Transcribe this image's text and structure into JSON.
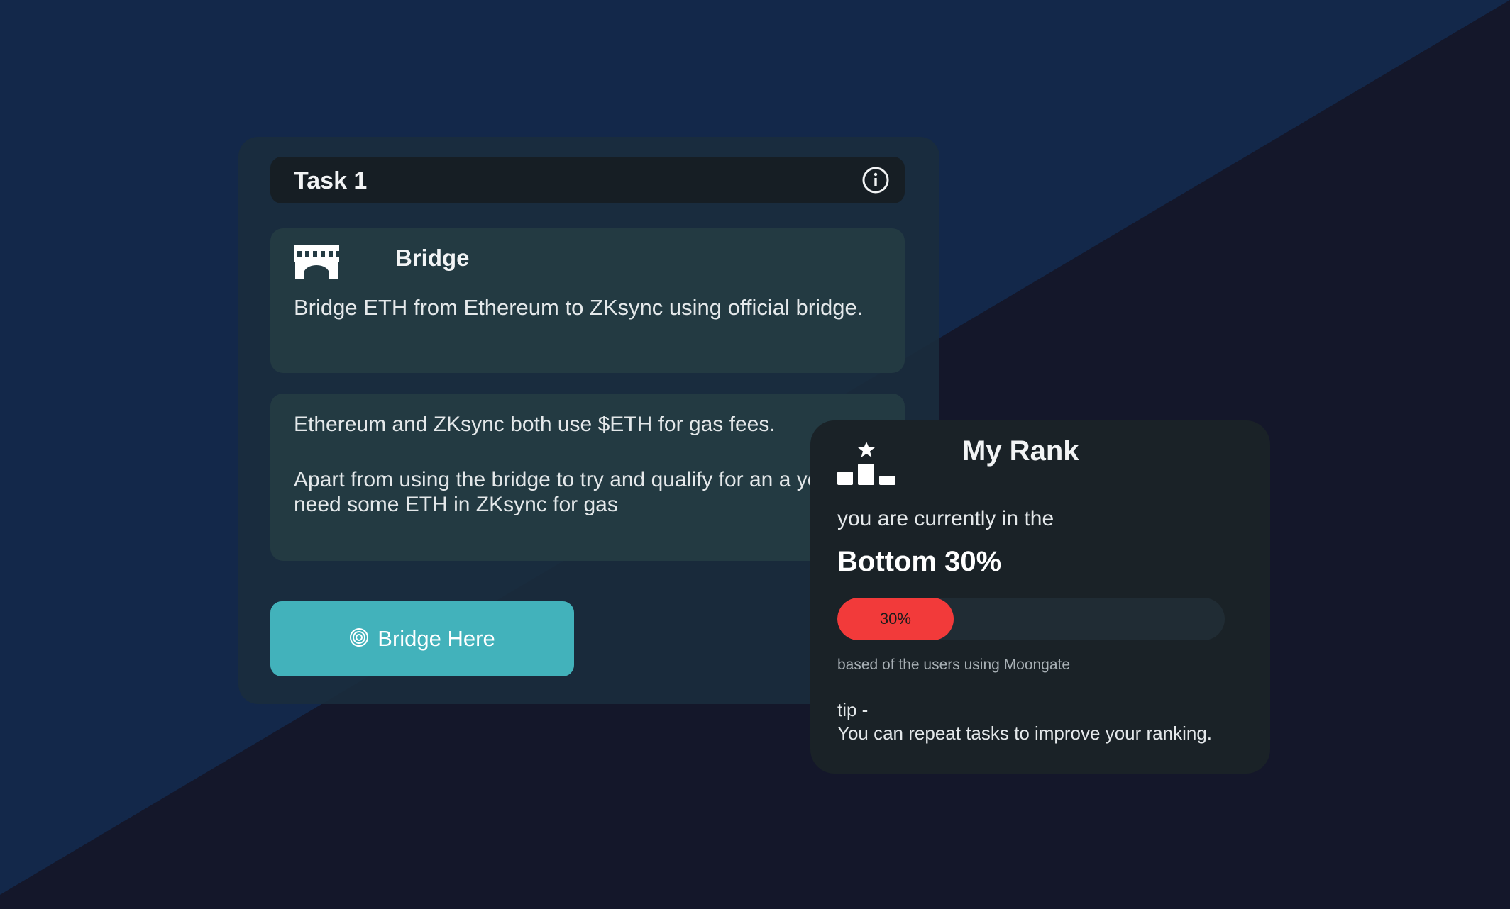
{
  "colors": {
    "background_light": "#13284a",
    "background_dark": "#14172a",
    "card": "#1a2c3d",
    "panel": "#233a42",
    "header": "#161e24",
    "accent": "#42b2bb",
    "progress": "#f23a3a"
  },
  "task": {
    "title": "Task 1",
    "info_icon": "info-icon",
    "bridge": {
      "icon": "bridge-icon",
      "title": "Bridge",
      "description": "Bridge ETH from Ethereum to ZKsync using official bridge."
    },
    "gas_note": {
      "line1": "Ethereum and ZKsync both use $ETH for gas fees.",
      "line2": "Apart from using the bridge to try and qualify for an a you’ll also need some ETH in ZKsync for gas"
    },
    "button": {
      "icon": "target-icon",
      "label": "Bridge Here"
    }
  },
  "rank": {
    "icon": "podium-star-icon",
    "title": "My Rank",
    "subtitle": "you are currently in the",
    "value": "Bottom 30%",
    "progress": {
      "percent": 30,
      "label": "30%"
    },
    "note": "based of the users using Moongate",
    "tip_label": "tip -",
    "tip_text": "You can repeat tasks to improve your ranking."
  }
}
